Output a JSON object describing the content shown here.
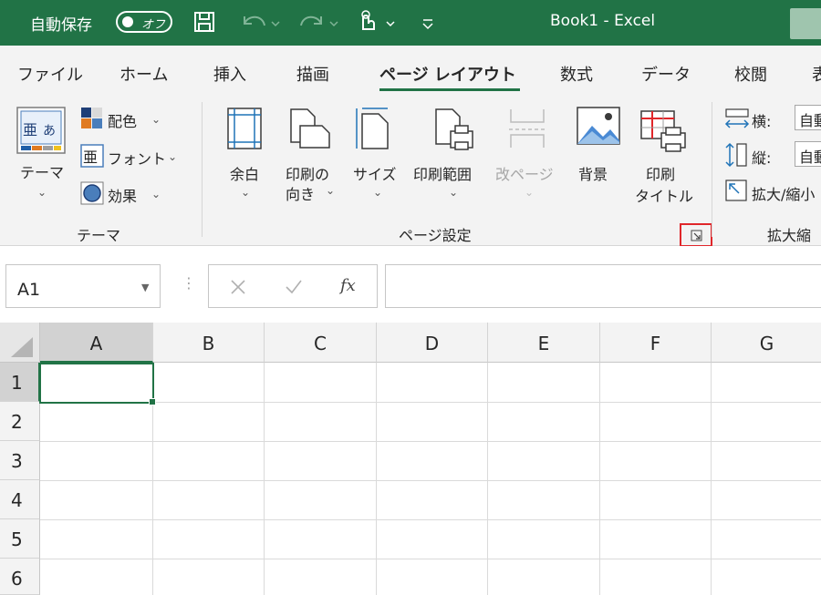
{
  "titlebar": {
    "autosave_label": "自動保存",
    "autosave_state": "オフ",
    "doc_title": "Book1  -  Excel"
  },
  "tabs": [
    {
      "label": "ファイル"
    },
    {
      "label": "ホーム"
    },
    {
      "label": "挿入"
    },
    {
      "label": "描画"
    },
    {
      "label": "ページ レイアウト",
      "active": true
    },
    {
      "label": "数式"
    },
    {
      "label": "データ"
    },
    {
      "label": "校閲"
    },
    {
      "label": "表"
    }
  ],
  "ribbon": {
    "theme_group": {
      "label": "テーマ",
      "themes_button": "テーマ",
      "colors": "配色",
      "fonts": "フォント",
      "effects": "効果"
    },
    "page_setup_group": {
      "label": "ページ設定",
      "margins": "余白",
      "orientation_line1": "印刷の",
      "orientation_line2": "向き",
      "size": "サイズ",
      "print_area": "印刷範囲",
      "breaks": "改ページ",
      "background": "背景",
      "print_titles_line1": "印刷",
      "print_titles_line2": "タイトル"
    },
    "scale_group": {
      "label": "拡大縮",
      "width_label": "横:",
      "width_value": "自動",
      "height_label": "縦:",
      "height_value": "自動",
      "scale_label": "拡大/縮小"
    }
  },
  "formula_bar": {
    "name_box": "A1",
    "fx_label": "fx",
    "formula": ""
  },
  "grid": {
    "columns": [
      "A",
      "B",
      "C",
      "D",
      "E",
      "F",
      "G"
    ],
    "rows": [
      "1",
      "2",
      "3",
      "4",
      "5",
      "6"
    ],
    "active_cell": "A1"
  },
  "colors": {
    "accent": "#217346",
    "launcher_highlight": "#e0262a"
  }
}
